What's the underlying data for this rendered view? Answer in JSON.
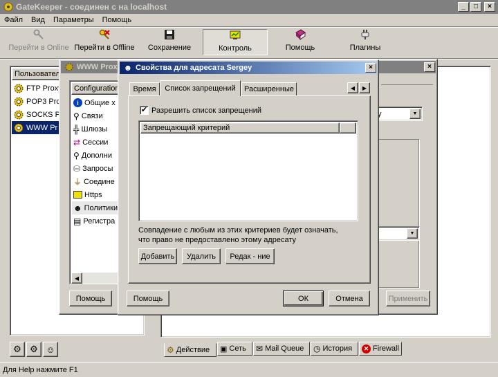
{
  "app": {
    "title": "GateKeeper - соединен с на localhost",
    "menu": [
      "Файл",
      "Вид",
      "Параметры",
      "Помощь"
    ],
    "toolbar": [
      {
        "label": "Перейти в Online",
        "icon": "key-icon",
        "disabled": true
      },
      {
        "label": "Перейти в Offline",
        "icon": "key-x-icon"
      },
      {
        "label": "Сохранение",
        "icon": "floppy-icon"
      },
      {
        "label": "Контроль",
        "icon": "monitor-icon",
        "pressed": true
      },
      {
        "label": "Помощь",
        "icon": "book-icon"
      },
      {
        "label": "Плагины",
        "icon": "plug-icon"
      }
    ],
    "status": "Для Help нажмите F1"
  },
  "left_panel": {
    "header": "Пользовател",
    "items": [
      "FTP Proxy",
      "POP3 Pro",
      "SOCKS P",
      "WWW Pr"
    ],
    "selected_index": 3
  },
  "bottom_tabs": [
    "Действие",
    "Сеть",
    "Mail Queue",
    "История",
    "Firewall"
  ],
  "www_proxy": {
    "title": "WWW Prox",
    "tree_header": "Configuration",
    "tree": [
      "Общие х",
      "Связи",
      "Шлюзы",
      "Сессии",
      "Дополни",
      "Запросы",
      "Соедине",
      "Https",
      "Политики",
      "Регистра"
    ],
    "help_button": "Помощь",
    "apply_button": "Применить",
    "combo_text": "y"
  },
  "dialog": {
    "title": "Свойства для адресата Sergey",
    "tabs": [
      "Время",
      "Список запрещений",
      "Расширенные"
    ],
    "active_tab": 1,
    "checkbox_label": "Разрешить список запрещений",
    "checkbox_checked": true,
    "list_header": "Запрещающий критерий",
    "note_line1": "Совпадение с любым из этих критериев будет означать,",
    "note_line2": "что право не предоставлено этому адресату",
    "add_button": "Добавить",
    "delete_button": "Удалить",
    "edit_button": "Редак - ние",
    "help_button": "Помощь",
    "ok_button": "ОК",
    "cancel_button": "Отмена"
  }
}
